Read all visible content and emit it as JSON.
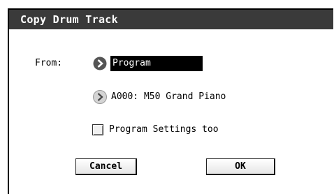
{
  "dialog": {
    "title": "Copy Drum Track",
    "from_label": "From:",
    "source_type": "Program",
    "source_program": "A000: M50 Grand Piano",
    "program_settings_label": "Program Settings too",
    "program_settings_checked": false
  },
  "buttons": {
    "cancel": "Cancel",
    "ok": "OK"
  },
  "icons": {
    "primary_arrow": "circle-arrow-right-icon",
    "secondary_arrow": "circle-arrow-right-icon"
  },
  "colors": {
    "titlebar": "#3a3a3a",
    "selected_field": "#000000",
    "arrow_primary": "#555555",
    "arrow_secondary": "#bdbdbd"
  }
}
